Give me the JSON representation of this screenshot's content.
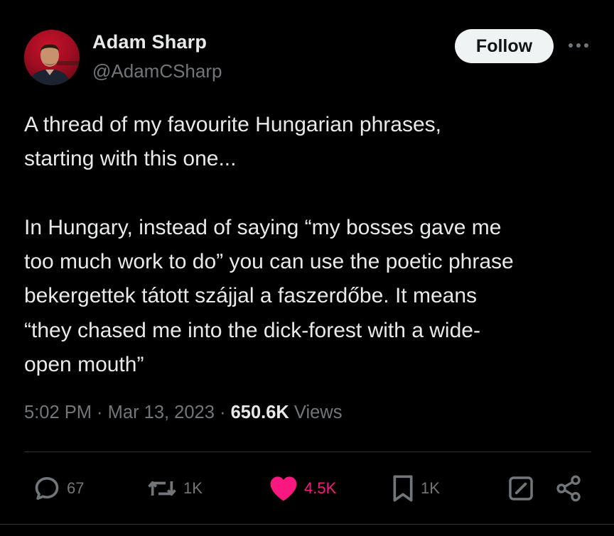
{
  "author": {
    "name": "Adam Sharp",
    "handle": "@AdamCSharp"
  },
  "follow_label": "Follow",
  "tweet": {
    "text": "A thread of my favourite Hungarian phrases,\nstarting with this one...\n\nIn Hungary, instead of saying “my bosses gave me\ntoo much work to do” you can use the poetic phrase\nbekergettek tátott szájjal a faszerdőbe. It means\n“they chased me into the dick-forest with a wide-\nopen mouth”"
  },
  "meta": {
    "time": "5:02 PM",
    "sep1": " · ",
    "date": "Mar 13, 2023",
    "sep2": " · ",
    "views_count": "650.6K",
    "views_label": "Views"
  },
  "actions": {
    "replies": "67",
    "retweets": "1K",
    "likes": "4.5K",
    "bookmarks": "1K"
  },
  "icons": {
    "reply": "reply-icon",
    "retweet": "retweet-icon",
    "like": "heart-icon",
    "bookmark": "bookmark-icon",
    "edit": "edit-icon",
    "share": "share-icon",
    "more": "more-icon"
  },
  "colors": {
    "background": "#000000",
    "text": "#e7e9ea",
    "secondary": "#71767b",
    "like": "#f91880",
    "follow_bg": "#eff3f4"
  }
}
